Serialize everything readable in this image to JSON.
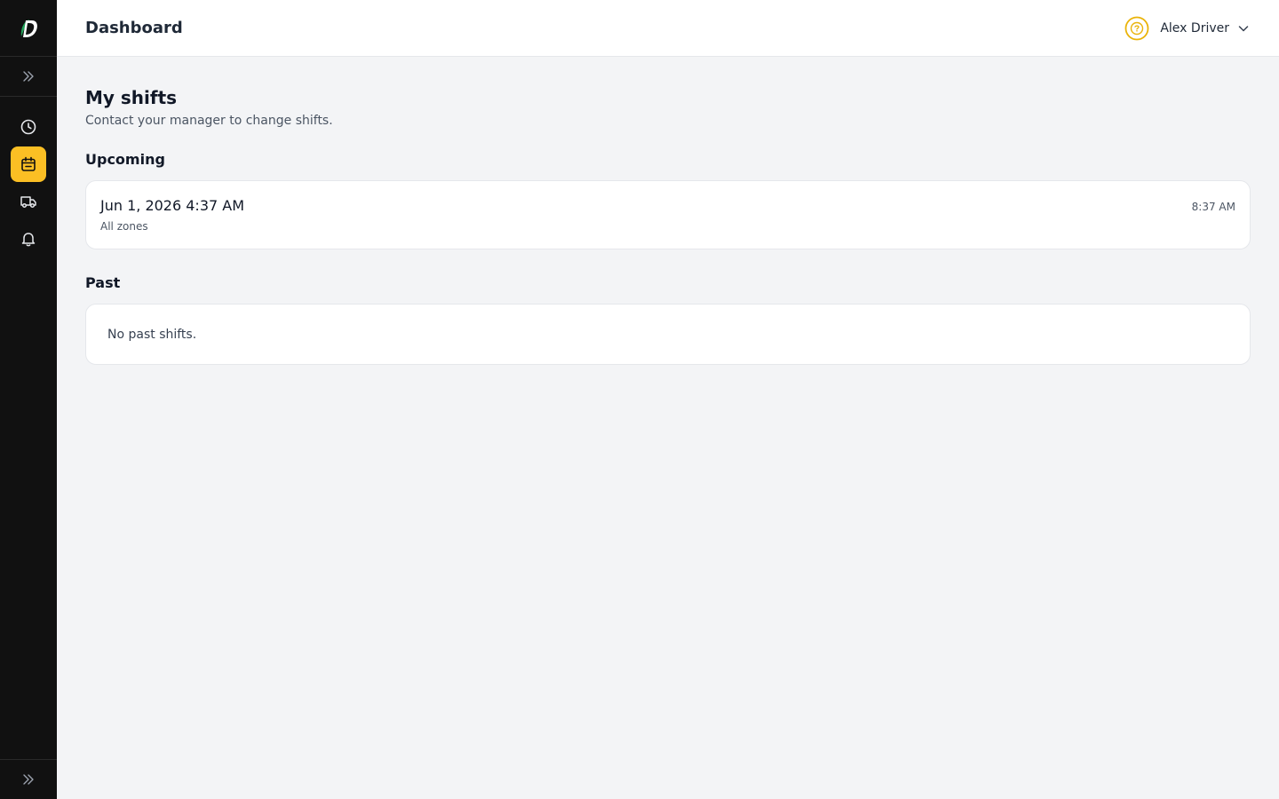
{
  "header": {
    "title": "Dashboard",
    "user_name": "Alex Driver"
  },
  "sidebar": {
    "items": [
      {
        "icon": "clock-icon",
        "active": false
      },
      {
        "icon": "calendar-icon",
        "active": true
      },
      {
        "icon": "truck-icon",
        "active": false
      },
      {
        "icon": "bell-icon",
        "active": false
      }
    ]
  },
  "main": {
    "title": "My shifts",
    "subtitle": "Contact your manager to change shifts.",
    "upcoming": {
      "title": "Upcoming",
      "shifts": [
        {
          "start": "Jun 1, 2026 4:37 AM",
          "zone": "All zones",
          "end": "8:37 AM"
        }
      ]
    },
    "past": {
      "title": "Past",
      "empty_text": "No past shifts."
    }
  },
  "colors": {
    "accent": "#fbbf24",
    "sidebar_bg": "#111111",
    "page_bg": "#f3f4f6",
    "logo_green": "#22a35a"
  }
}
